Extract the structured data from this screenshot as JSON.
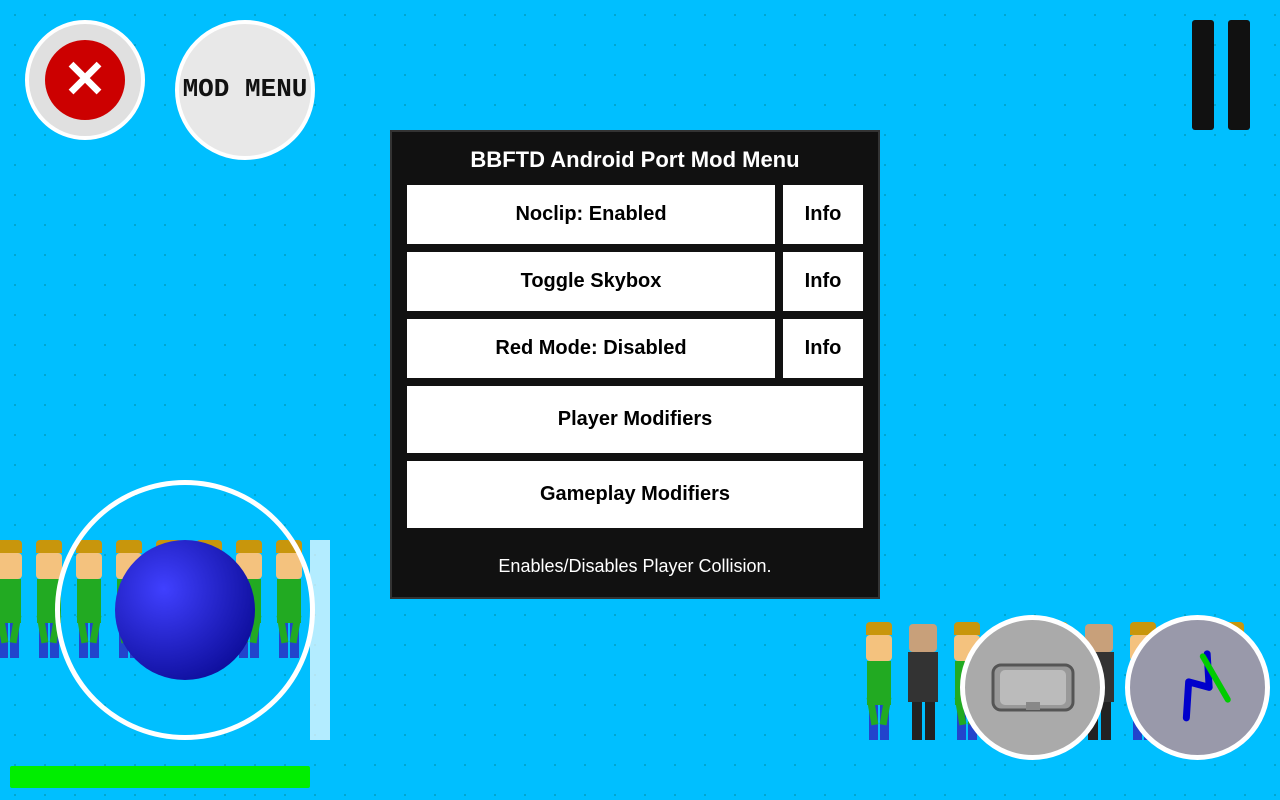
{
  "title": "BBFTD Android Port Mod Menu",
  "close_button": {
    "label": "✕"
  },
  "mod_menu_button": {
    "label": "MOD\nMENU"
  },
  "panel": {
    "title": "BBFTD Android Port Mod Menu",
    "rows": [
      {
        "id": "noclip",
        "main_label": "Noclip: Enabled",
        "info_label": "Info",
        "has_info": true
      },
      {
        "id": "skybox",
        "main_label": "Toggle Skybox",
        "info_label": "Info",
        "has_info": true
      },
      {
        "id": "redmode",
        "main_label": "Red Mode: Disabled",
        "info_label": "Info",
        "has_info": true
      },
      {
        "id": "player-mod",
        "main_label": "Player Modifiers",
        "has_info": false
      },
      {
        "id": "gameplay-mod",
        "main_label": "Gameplay Modifiers",
        "has_info": false
      }
    ],
    "description": "Enables/Disables Player Collision."
  },
  "pause_bars": 2,
  "status_bar": {
    "color": "#00ee00"
  },
  "icons": {
    "close": "✕",
    "pause": "||"
  }
}
